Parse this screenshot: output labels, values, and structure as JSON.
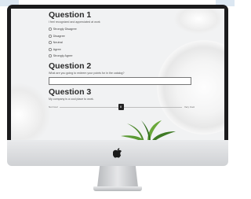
{
  "survey": {
    "q1": {
      "title": "Question 1",
      "text": "I feel recognized and appreciated at work",
      "options": [
        "Strongly Disagree",
        "Disagree",
        "Neutral",
        "Agree",
        "Strongly Agree"
      ]
    },
    "q2": {
      "title": "Question 2",
      "text": "What are you going to redeem your points for in the catalog?",
      "answer_value": ""
    },
    "q3": {
      "title": "Question 3",
      "text": "My company is a cool place to work.",
      "slider": {
        "min_label": "Not Cool",
        "max_label": "Very Cool",
        "value_label": "8",
        "value_fraction": 0.5
      }
    }
  },
  "icons": {
    "radio": "radio-button-icon",
    "apple": "apple-logo-icon",
    "plant": "plant-decoration"
  },
  "colors": {
    "bezel": "#1b1b1d",
    "screen_bg": "#f1f2f3",
    "accent": "#dce7f2"
  }
}
